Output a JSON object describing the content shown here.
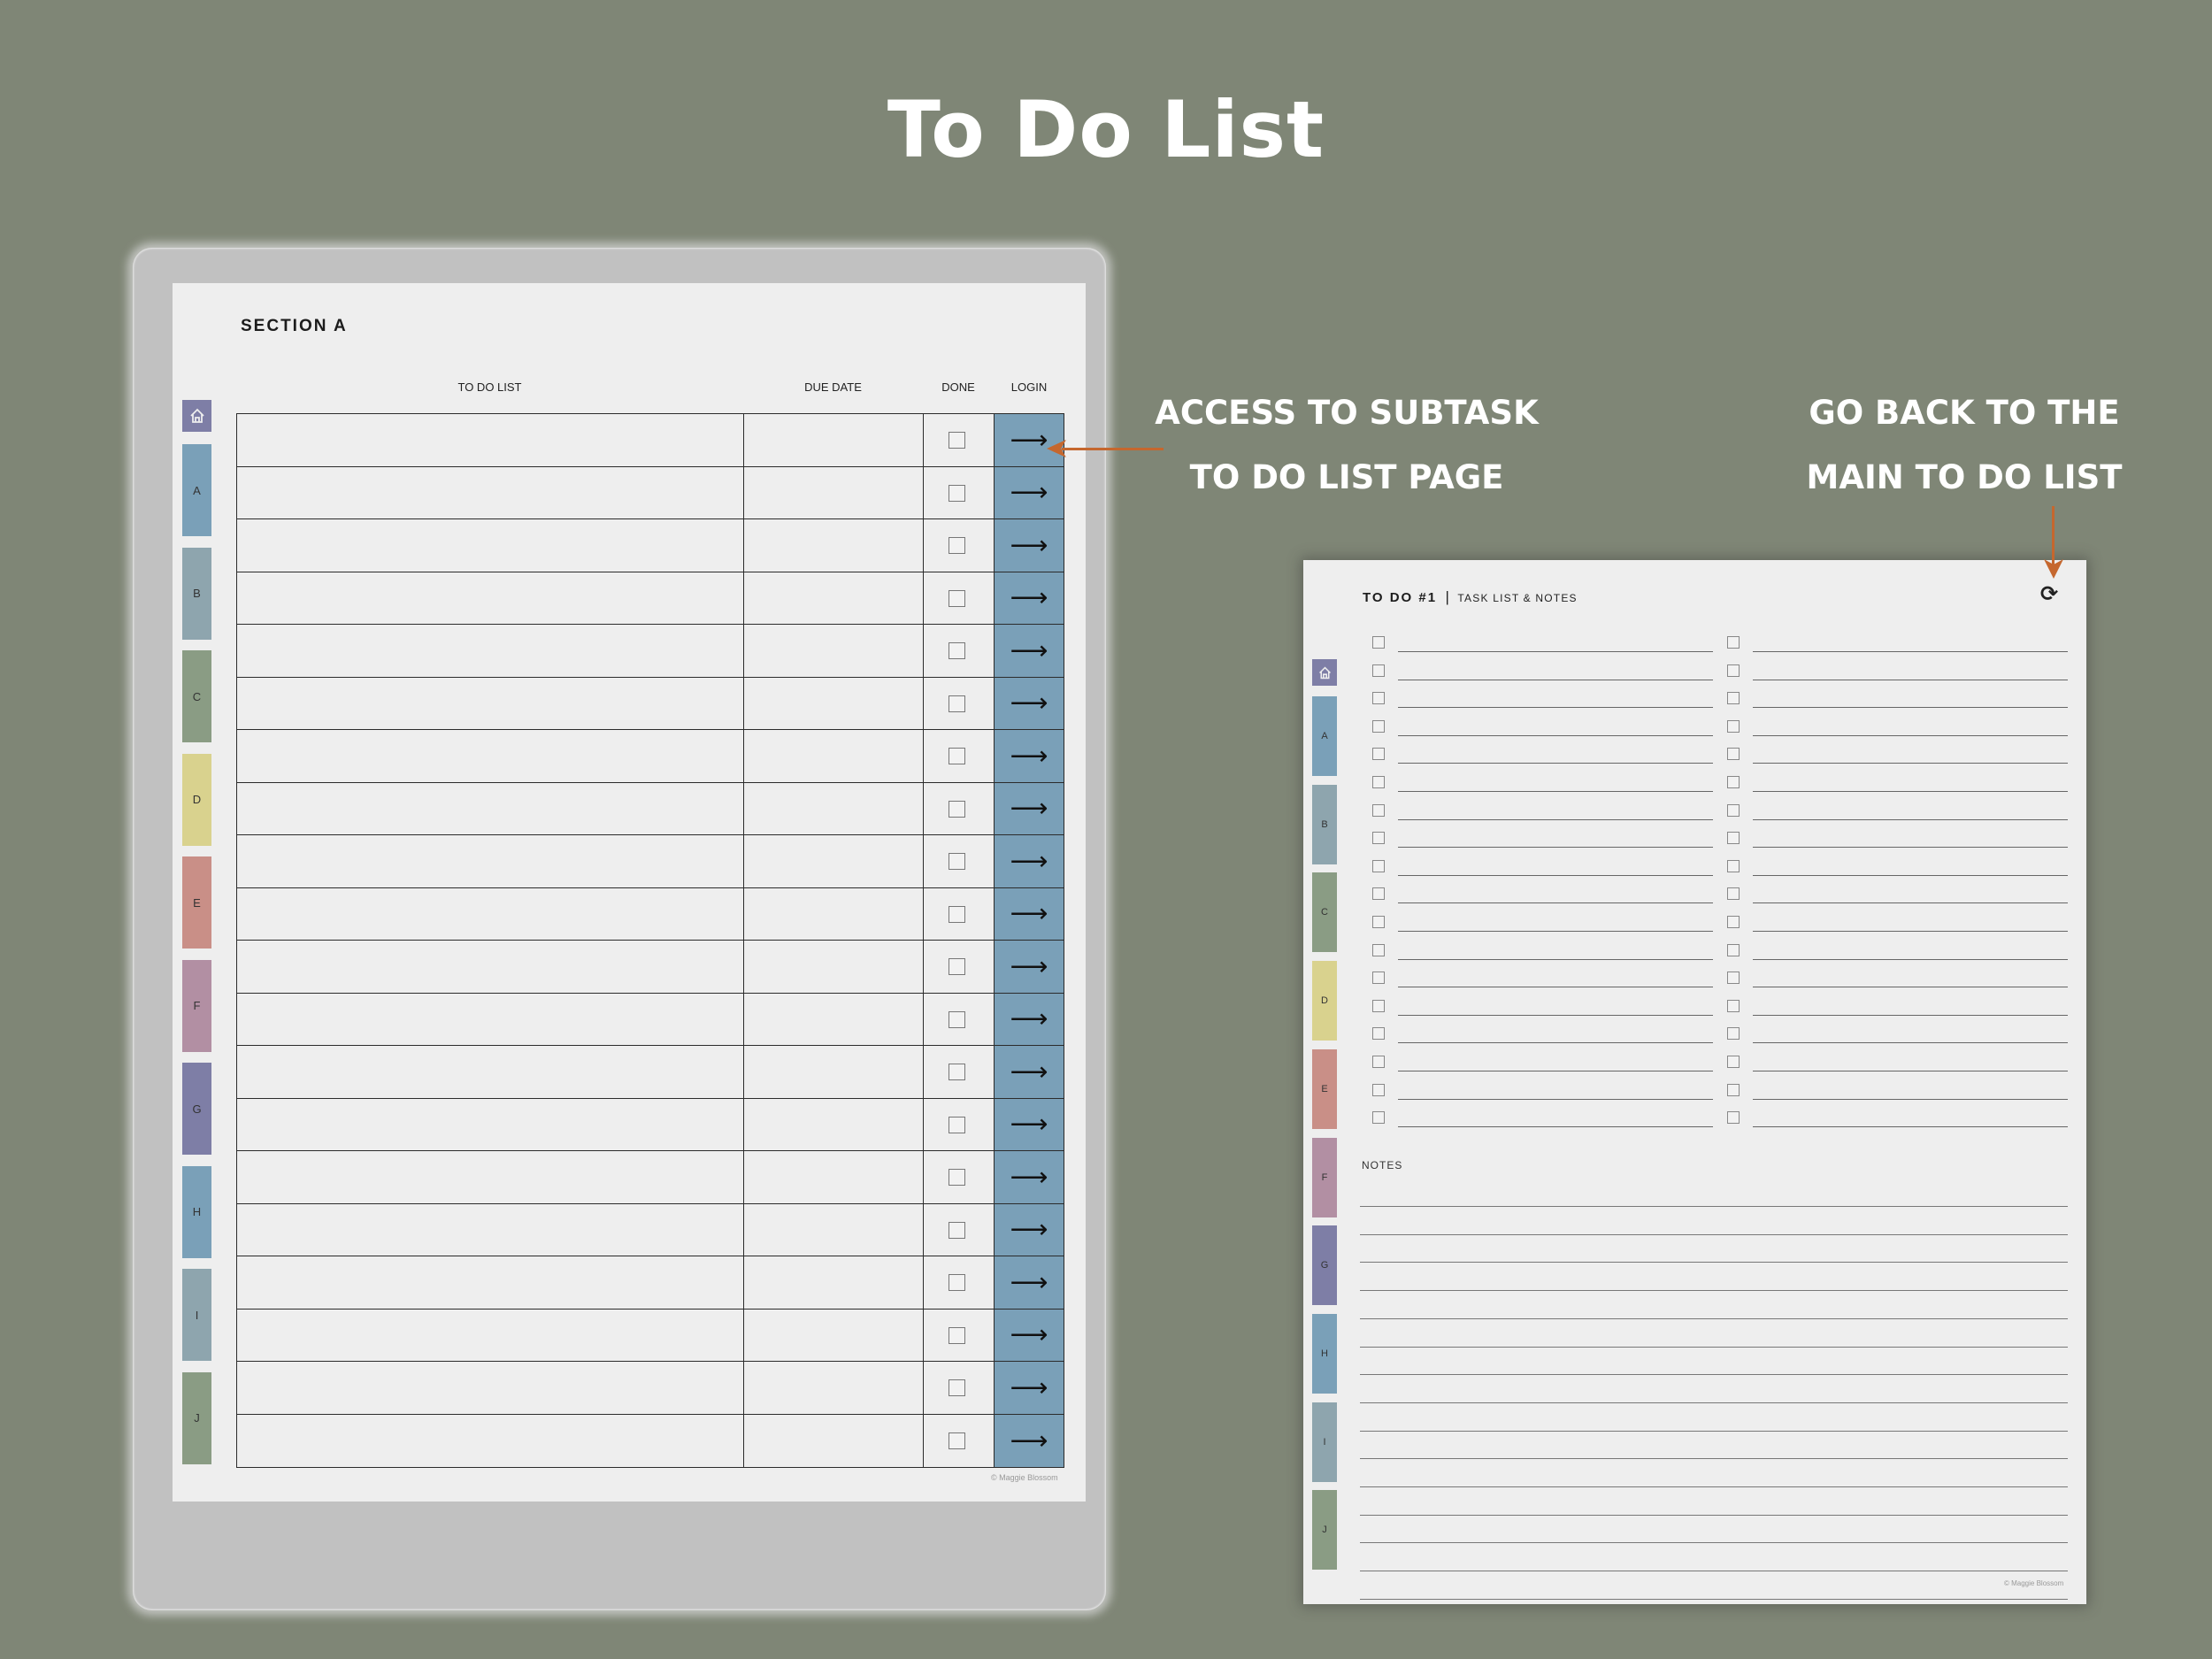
{
  "page_title": "To Do List",
  "annotations": {
    "left": [
      "ACCESS TO SUBTASK",
      "TO DO LIST PAGE"
    ],
    "right": [
      "GO BACK TO THE",
      "MAIN TO DO LIST"
    ]
  },
  "accent_color": "#c5672e",
  "left_page": {
    "section_title": "SECTION A",
    "columns": {
      "task": "TO DO LIST",
      "due": "DUE DATE",
      "done": "DONE",
      "link": "LOGIN"
    },
    "row_count": 20,
    "link_icon": "arrow-right-icon",
    "link_glyph": "⟶",
    "footer": "© Maggie Blossom"
  },
  "tabs": [
    {
      "label": "",
      "icon": "home-icon",
      "color": "#7e7ea6"
    },
    {
      "label": "A",
      "color": "#7aa0b8"
    },
    {
      "label": "B",
      "color": "#8ea5ae"
    },
    {
      "label": "C",
      "color": "#8a9c84"
    },
    {
      "label": "D",
      "color": "#d9d28e"
    },
    {
      "label": "E",
      "color": "#c98f87"
    },
    {
      "label": "F",
      "color": "#b28fa3"
    },
    {
      "label": "G",
      "color": "#7e7ea6"
    },
    {
      "label": "H",
      "color": "#7aa0b8"
    },
    {
      "label": "I",
      "color": "#8ea5ae"
    },
    {
      "label": "J",
      "color": "#8a9c84"
    }
  ],
  "right_page": {
    "title": "TO DO #1",
    "separator": "|",
    "subtitle": "TASK LIST & NOTES",
    "back_icon": "refresh-icon",
    "back_glyph": "⟳",
    "rows_per_column": 18,
    "notes_label": "NOTES",
    "notes_line_count": 15,
    "footer": "© Maggie Blossom"
  }
}
